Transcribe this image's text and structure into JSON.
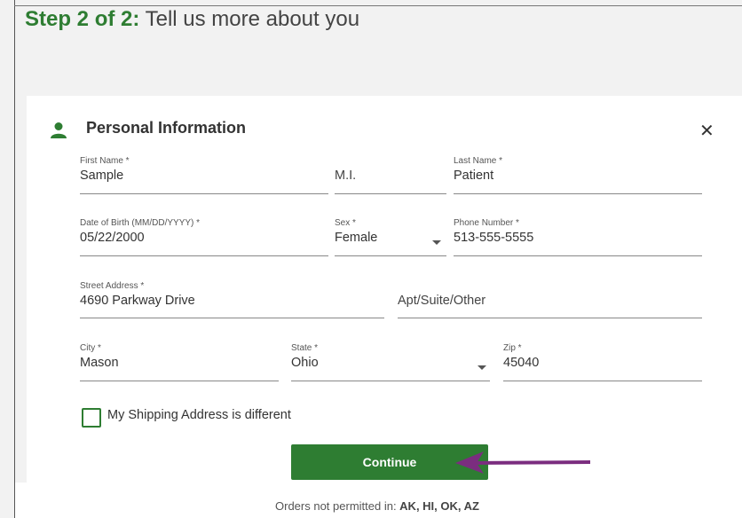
{
  "header": {
    "step_label": "Step 2 of 2:",
    "step_title": " Tell us more about you"
  },
  "section": {
    "title": "Personal Information",
    "icon": "person-icon",
    "close_icon": "close-icon"
  },
  "form": {
    "first_name": {
      "label": "First Name *",
      "value": "Sample"
    },
    "middle_initial": {
      "placeholder": "M.I."
    },
    "last_name": {
      "label": "Last Name *",
      "value": "Patient"
    },
    "dob": {
      "label": "Date of Birth (MM/DD/YYYY) *",
      "value": "05/22/2000"
    },
    "sex": {
      "label": "Sex *",
      "value": "Female"
    },
    "phone": {
      "label": "Phone Number *",
      "value": "513-555-5555"
    },
    "street": {
      "label": "Street Address *",
      "value": "4690 Parkway Drive"
    },
    "apt": {
      "placeholder": "Apt/Suite/Other"
    },
    "city": {
      "label": "City *",
      "value": "Mason"
    },
    "state": {
      "label": "State *",
      "value": "Ohio"
    },
    "zip": {
      "label": "Zip *",
      "value": "45040"
    },
    "shipping_checkbox": {
      "label": "My Shipping Address is different",
      "checked": false
    }
  },
  "continue_label": "Continue",
  "footer": {
    "orders_prefix": "Orders not permitted in: ",
    "orders_states": "AK, HI, OK, AZ"
  },
  "colors": {
    "brand_green": "#2e7d32",
    "annotation_arrow": "#7b2d7f"
  }
}
